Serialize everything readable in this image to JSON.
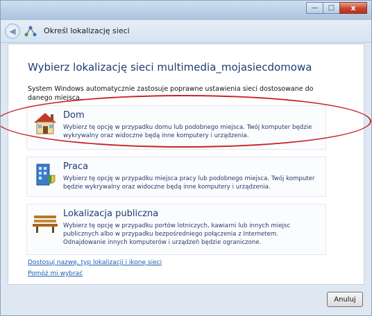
{
  "window": {
    "controls": {
      "minimize": "—",
      "maximize": "□",
      "close": "x"
    }
  },
  "navbar": {
    "title": "Określ lokalizację sieci"
  },
  "main": {
    "heading": "Wybierz lokalizację sieci multimedia_mojasiecdomowa",
    "description": "System Windows automatycznie zastosuje poprawne ustawienia sieci dostosowane do danego miejsca.",
    "options": [
      {
        "title": "Dom",
        "text": "Wybierz tę opcję w przypadku domu lub podobnego miejsca. Twój komputer będzie wykrywalny oraz widoczne będą inne komputery i urządzenia."
      },
      {
        "title": "Praca",
        "text": "Wybierz tę opcję w przypadku miejsca pracy lub podobnego miejsca. Twój komputer będzie wykrywalny oraz widoczne będą inne komputery i urządzenia."
      },
      {
        "title": "Lokalizacja publiczna",
        "text": "Wybierz tę opcję w przypadku portów lotniczych, kawiarni lub innych miejsc publicznych albo w przypadku bezpośredniego połączenia z Internetem. Odnajdowanie innych komputerów i urządzeń będzie ograniczone."
      }
    ],
    "links": {
      "customize": "Dostosuj nazwę, typ lokalizacji i ikonę sieci",
      "help": "Pomóż mi wybrać"
    }
  },
  "footer": {
    "cancel_label": "Anuluj"
  },
  "colors": {
    "heading": "#1f3b70",
    "link": "#1a5fb4",
    "highlight": "#c8232c"
  },
  "icons": {
    "back": "back-arrow-icon",
    "network": "network-icon",
    "home": "house-icon",
    "work": "office-building-icon",
    "public": "park-bench-icon"
  }
}
